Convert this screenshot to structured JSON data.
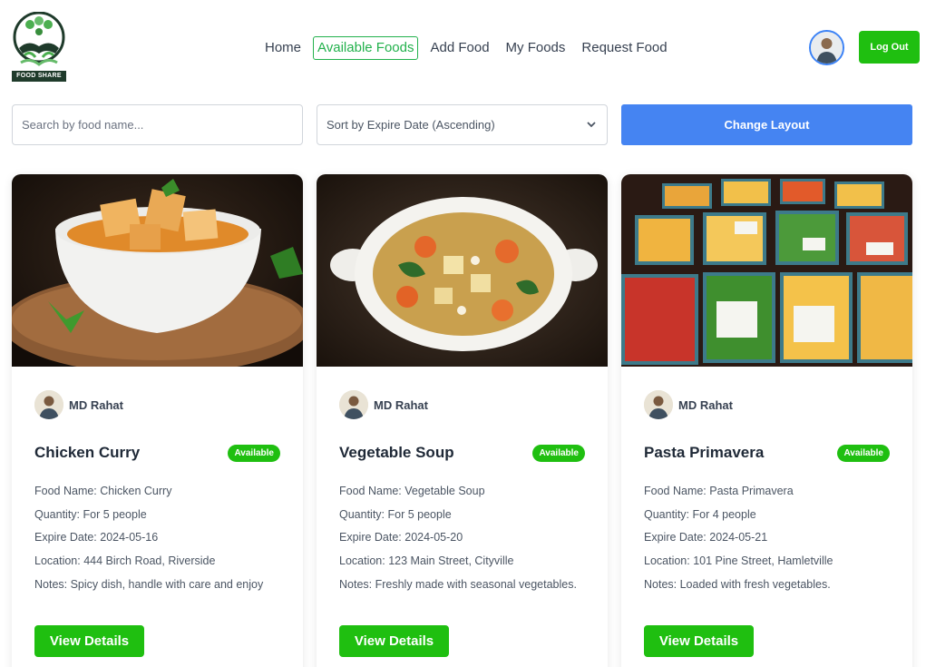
{
  "logo": {
    "text": "FOOD SHARE"
  },
  "nav": {
    "items": [
      {
        "label": "Home",
        "active": false
      },
      {
        "label": "Available Foods",
        "active": true
      },
      {
        "label": "Add Food",
        "active": false
      },
      {
        "label": "My Foods",
        "active": false
      },
      {
        "label": "Request Food",
        "active": false
      }
    ],
    "logout_label": "Log Out"
  },
  "controls": {
    "search_placeholder": "Search by food name...",
    "sort_value": "Sort by Expire Date (Ascending)",
    "change_layout_label": "Change Layout"
  },
  "cards": [
    {
      "owner": "MD Rahat",
      "title": "Chicken Curry",
      "status": "Available",
      "food_name": "Food Name: Chicken Curry",
      "quantity": "Quantity: For 5 people",
      "expire": "Expire Date: 2024-05-16",
      "location": "Location: 444 Birch Road, Riverside",
      "notes": "Notes: Spicy dish, handle with care and enjoy",
      "button": "View Details"
    },
    {
      "owner": "MD Rahat",
      "title": "Vegetable Soup",
      "status": "Available",
      "food_name": "Food Name: Vegetable Soup",
      "quantity": "Quantity: For 5 people",
      "expire": "Expire Date: 2024-05-20",
      "location": "Location: 123 Main Street, Cityville",
      "notes": "Notes: Freshly made with seasonal vegetables.",
      "button": "View Details"
    },
    {
      "owner": "MD Rahat",
      "title": "Pasta Primavera",
      "status": "Available",
      "food_name": "Food Name: Pasta Primavera",
      "quantity": "Quantity: For 4 people",
      "expire": "Expire Date: 2024-05-21",
      "location": "Location: 101 Pine Street, Hamletville",
      "notes": "Notes: Loaded with fresh vegetables.",
      "button": "View Details"
    }
  ],
  "colors": {
    "brand_green": "#1fbf10",
    "nav_active": "#22b14c",
    "layout_button": "#4584f2"
  }
}
